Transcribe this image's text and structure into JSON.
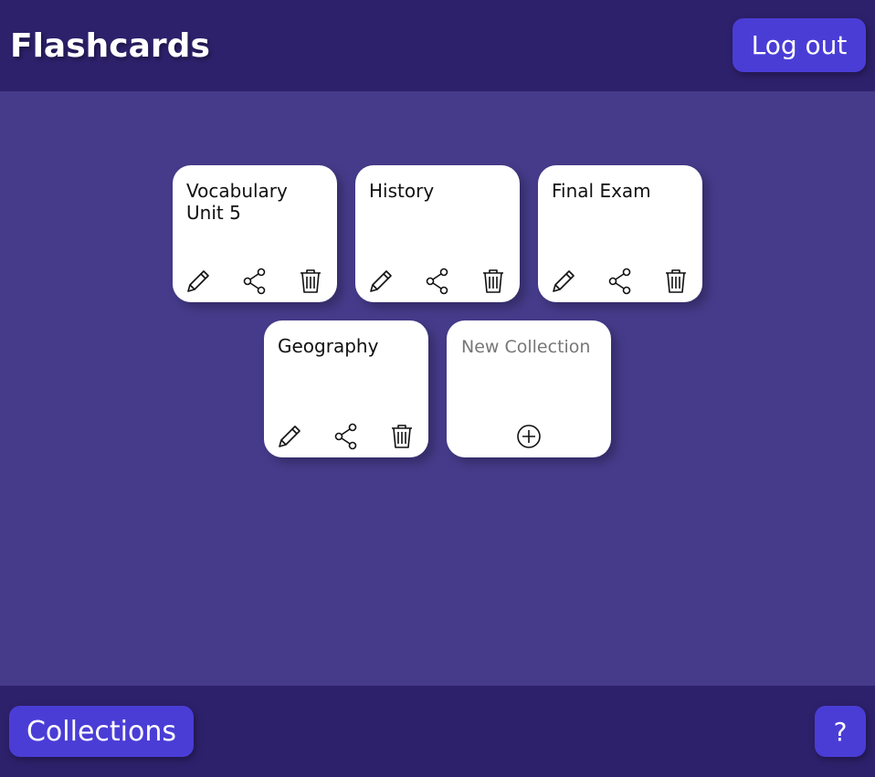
{
  "header": {
    "title": "Flashcards",
    "logout_label": "Log out"
  },
  "collections": [
    {
      "title": "Vocabulary Unit 5"
    },
    {
      "title": "History"
    },
    {
      "title": "Final Exam"
    },
    {
      "title": "Geography"
    }
  ],
  "new_collection": {
    "placeholder": "New Collection",
    "value": ""
  },
  "footer": {
    "collections_label": "Collections",
    "help_label": "?"
  },
  "colors": {
    "background": "#453b8a",
    "bar": "#2e216c",
    "button": "#4a3dd6",
    "card": "#ffffff"
  },
  "icons": {
    "edit": "pencil-icon",
    "share": "share-icon",
    "delete": "trash-icon",
    "add": "plus-circle-icon"
  }
}
